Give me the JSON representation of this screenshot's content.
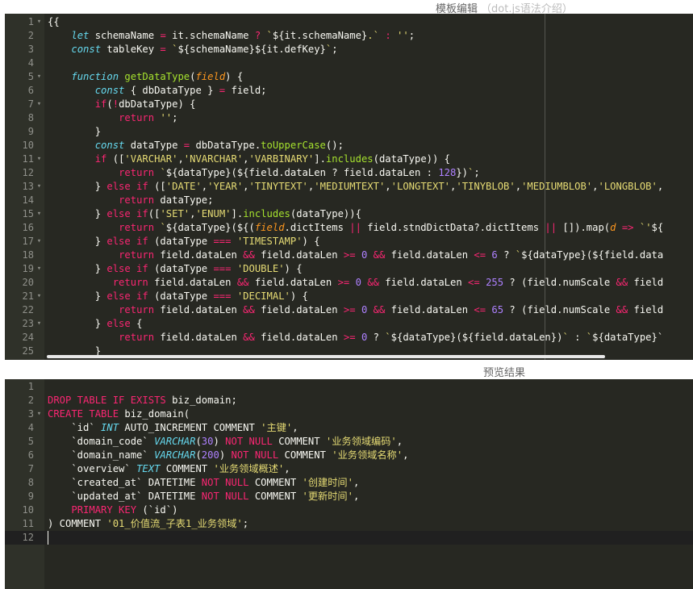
{
  "template_section": {
    "title": "模板编辑",
    "subtitle": "（dot.js语法介绍）"
  },
  "preview_section": {
    "title": "预览结果"
  },
  "template_code": [
    [
      [
        "t",
        "{{"
      ]
    ],
    [
      [
        "t",
        "    "
      ],
      [
        "sp",
        "let"
      ],
      [
        "t",
        " schemaName "
      ],
      [
        "kw",
        "="
      ],
      [
        "t",
        " it.schemaName "
      ],
      [
        "kw",
        "?"
      ],
      [
        "t",
        " "
      ],
      [
        "st",
        "`"
      ],
      [
        "t",
        "${it.schemaName}"
      ],
      [
        "st",
        ".`"
      ],
      [
        "t",
        " "
      ],
      [
        "kw",
        ":"
      ],
      [
        "t",
        " "
      ],
      [
        "st",
        "''"
      ],
      [
        "t",
        ";"
      ]
    ],
    [
      [
        "t",
        "    "
      ],
      [
        "sp",
        "const"
      ],
      [
        "t",
        " tableKey "
      ],
      [
        "kw",
        "="
      ],
      [
        "t",
        " "
      ],
      [
        "st",
        "`"
      ],
      [
        "t",
        "${schemaName}${it.defKey}"
      ],
      [
        "st",
        "`"
      ],
      [
        "t",
        ";"
      ]
    ],
    [
      [
        "t",
        ""
      ]
    ],
    [
      [
        "t",
        "    "
      ],
      [
        "sp",
        "function"
      ],
      [
        "t",
        " "
      ],
      [
        "fn",
        "getDataType"
      ],
      [
        "t",
        "("
      ],
      [
        "pa",
        "field"
      ],
      [
        "t",
        ") {"
      ]
    ],
    [
      [
        "t",
        "        "
      ],
      [
        "sp",
        "const"
      ],
      [
        "t",
        " { dbDataType } "
      ],
      [
        "kw",
        "="
      ],
      [
        "t",
        " field;"
      ]
    ],
    [
      [
        "t",
        "        "
      ],
      [
        "kw",
        "if"
      ],
      [
        "t",
        "("
      ],
      [
        "kw",
        "!"
      ],
      [
        "t",
        "dbDataType) {"
      ]
    ],
    [
      [
        "t",
        "            "
      ],
      [
        "kw",
        "return"
      ],
      [
        "t",
        " "
      ],
      [
        "st",
        "''"
      ],
      [
        "t",
        ";"
      ]
    ],
    [
      [
        "t",
        "        }"
      ]
    ],
    [
      [
        "t",
        "        "
      ],
      [
        "sp",
        "const"
      ],
      [
        "t",
        " dataType "
      ],
      [
        "kw",
        "="
      ],
      [
        "t",
        " dbDataType."
      ],
      [
        "fn",
        "toUpperCase"
      ],
      [
        "t",
        "();"
      ]
    ],
    [
      [
        "t",
        "        "
      ],
      [
        "kw",
        "if"
      ],
      [
        "t",
        " (["
      ],
      [
        "st",
        "'VARCHAR'"
      ],
      [
        "t",
        ","
      ],
      [
        "st",
        "'NVARCHAR'"
      ],
      [
        "t",
        ","
      ],
      [
        "st",
        "'VARBINARY'"
      ],
      [
        "t",
        "]."
      ],
      [
        "fn",
        "includes"
      ],
      [
        "t",
        "(dataType)) {"
      ]
    ],
    [
      [
        "t",
        "            "
      ],
      [
        "kw",
        "return"
      ],
      [
        "t",
        " "
      ],
      [
        "st",
        "`"
      ],
      [
        "t",
        "${dataType}("
      ],
      [
        "t",
        "${field.dataLen ? field.dataLen : "
      ],
      [
        "nu",
        "128"
      ],
      [
        "t",
        "})"
      ],
      [
        "st",
        "`"
      ],
      [
        "t",
        ";"
      ]
    ],
    [
      [
        "t",
        "        } "
      ],
      [
        "kw",
        "else if"
      ],
      [
        "t",
        " (["
      ],
      [
        "st",
        "'DATE'"
      ],
      [
        "t",
        ","
      ],
      [
        "st",
        "'YEAR'"
      ],
      [
        "t",
        ","
      ],
      [
        "st",
        "'TINYTEXT'"
      ],
      [
        "t",
        ","
      ],
      [
        "st",
        "'MEDIUMTEXT'"
      ],
      [
        "t",
        ","
      ],
      [
        "st",
        "'LONGTEXT'"
      ],
      [
        "t",
        ","
      ],
      [
        "st",
        "'TINYBLOB'"
      ],
      [
        "t",
        ","
      ],
      [
        "st",
        "'MEDIUMBLOB'"
      ],
      [
        "t",
        ","
      ],
      [
        "st",
        "'LONGBLOB'"
      ],
      [
        "t",
        ","
      ]
    ],
    [
      [
        "t",
        "            "
      ],
      [
        "kw",
        "return"
      ],
      [
        "t",
        " dataType;"
      ]
    ],
    [
      [
        "t",
        "        } "
      ],
      [
        "kw",
        "else if"
      ],
      [
        "t",
        "(["
      ],
      [
        "st",
        "'SET'"
      ],
      [
        "t",
        ","
      ],
      [
        "st",
        "'ENUM'"
      ],
      [
        "t",
        "]."
      ],
      [
        "fn",
        "includes"
      ],
      [
        "t",
        "(dataType)){"
      ]
    ],
    [
      [
        "t",
        "            "
      ],
      [
        "kw",
        "return"
      ],
      [
        "t",
        " "
      ],
      [
        "st",
        "`"
      ],
      [
        "t",
        "${dataType}(${("
      ],
      [
        "pa",
        "field"
      ],
      [
        "t",
        ".dictItems "
      ],
      [
        "kw",
        "||"
      ],
      [
        "t",
        " field.stndDictData?.dictItems "
      ],
      [
        "kw",
        "||"
      ],
      [
        "t",
        " []).map("
      ],
      [
        "pa",
        "d"
      ],
      [
        "t",
        " "
      ],
      [
        "kw",
        "=>"
      ],
      [
        "t",
        " "
      ],
      [
        "st",
        "`'"
      ],
      [
        "t",
        "${"
      ]
    ],
    [
      [
        "t",
        "        } "
      ],
      [
        "kw",
        "else if"
      ],
      [
        "t",
        " (dataType "
      ],
      [
        "kw",
        "==="
      ],
      [
        "t",
        " "
      ],
      [
        "st",
        "'TIMESTAMP'"
      ],
      [
        "t",
        ") {"
      ]
    ],
    [
      [
        "t",
        "            "
      ],
      [
        "kw",
        "return"
      ],
      [
        "t",
        " field.dataLen "
      ],
      [
        "kw",
        "&&"
      ],
      [
        "t",
        " field.dataLen "
      ],
      [
        "kw",
        "&gt;="
      ],
      [
        "t",
        " "
      ],
      [
        "nu",
        "0"
      ],
      [
        "t",
        " "
      ],
      [
        "kw",
        "&amp;&amp;"
      ],
      [
        "t",
        " field.dataLen "
      ],
      [
        "kw",
        "&lt;="
      ],
      [
        "t",
        " "
      ],
      [
        "nu",
        "6"
      ],
      [
        "t",
        " ? "
      ],
      [
        "st",
        "`"
      ],
      [
        "t",
        "${dataType}(${field.data"
      ]
    ],
    [
      [
        "t",
        "        } "
      ],
      [
        "kw",
        "else if"
      ],
      [
        "t",
        " (dataType "
      ],
      [
        "kw",
        "==="
      ],
      [
        "t",
        " "
      ],
      [
        "st",
        "'DOUBLE'"
      ],
      [
        "t",
        ") {"
      ]
    ],
    [
      [
        "t",
        "           "
      ],
      [
        "kw",
        "return"
      ],
      [
        "t",
        " field.dataLen "
      ],
      [
        "kw",
        "&&"
      ],
      [
        "t",
        " field.dataLen "
      ],
      [
        "kw",
        "&gt;="
      ],
      [
        "t",
        " "
      ],
      [
        "nu",
        "0"
      ],
      [
        "t",
        " "
      ],
      [
        "kw",
        "&amp;&amp;"
      ],
      [
        "t",
        " field.dataLen "
      ],
      [
        "kw",
        "&lt;="
      ],
      [
        "t",
        " "
      ],
      [
        "nu",
        "255"
      ],
      [
        "t",
        " ? (field.numScale "
      ],
      [
        "kw",
        "&&"
      ],
      [
        "t",
        " field"
      ]
    ],
    [
      [
        "t",
        "        } "
      ],
      [
        "kw",
        "else if"
      ],
      [
        "t",
        " (dataType "
      ],
      [
        "kw",
        "==="
      ],
      [
        "t",
        " "
      ],
      [
        "st",
        "'DECIMAL'"
      ],
      [
        "t",
        ") {"
      ]
    ],
    [
      [
        "t",
        "            "
      ],
      [
        "kw",
        "return"
      ],
      [
        "t",
        " field.dataLen "
      ],
      [
        "kw",
        "&&"
      ],
      [
        "t",
        " field.dataLen "
      ],
      [
        "kw",
        "&gt;="
      ],
      [
        "t",
        " "
      ],
      [
        "nu",
        "0"
      ],
      [
        "t",
        " "
      ],
      [
        "kw",
        "&amp;&amp;"
      ],
      [
        "t",
        " field.dataLen "
      ],
      [
        "kw",
        "&lt;="
      ],
      [
        "t",
        " "
      ],
      [
        "nu",
        "65"
      ],
      [
        "t",
        " ? (field.numScale "
      ],
      [
        "kw",
        "&&"
      ],
      [
        "t",
        " field"
      ]
    ],
    [
      [
        "t",
        "        } "
      ],
      [
        "kw",
        "else"
      ],
      [
        "t",
        " {"
      ]
    ],
    [
      [
        "t",
        "            "
      ],
      [
        "kw",
        "return"
      ],
      [
        "t",
        " field.dataLen "
      ],
      [
        "kw",
        "&&"
      ],
      [
        "t",
        " field.dataLen "
      ],
      [
        "kw",
        "&gt;="
      ],
      [
        "t",
        " "
      ],
      [
        "nu",
        "0"
      ],
      [
        "t",
        " ? "
      ],
      [
        "st",
        "`"
      ],
      [
        "t",
        "${dataType}(${field.dataLen})"
      ],
      [
        "st",
        "`"
      ],
      [
        "t",
        " : "
      ],
      [
        "st",
        "`"
      ],
      [
        "t",
        "${dataType}`"
      ]
    ],
    [
      [
        "t",
        "        }"
      ]
    ]
  ],
  "template_line_numbers": [
    "1",
    "2",
    "3",
    "4",
    "5",
    "6",
    "7",
    "8",
    "9",
    "10",
    "11",
    "12",
    "13",
    "14",
    "15",
    "16",
    "17",
    "18",
    "19",
    "20",
    "21",
    "22",
    "23",
    "24",
    "25"
  ],
  "template_fold_lines": [
    1,
    5,
    7,
    11,
    13,
    15,
    17,
    19,
    21,
    23
  ],
  "preview_code": [
    [
      [
        "t",
        ""
      ]
    ],
    [
      [
        "kw",
        "DROP TABLE IF EXISTS"
      ],
      [
        "t",
        " biz_domain;"
      ]
    ],
    [
      [
        "kw",
        "CREATE TABLE"
      ],
      [
        "t",
        " biz_domain("
      ]
    ],
    [
      [
        "t",
        "    `id` "
      ],
      [
        "sp",
        "INT"
      ],
      [
        "t",
        " AUTO_INCREMENT COMMENT "
      ],
      [
        "st",
        "'主键'"
      ],
      [
        "t",
        ","
      ]
    ],
    [
      [
        "t",
        "    `domain_code` "
      ],
      [
        "sp",
        "VARCHAR"
      ],
      [
        "t",
        "("
      ],
      [
        "nu",
        "30"
      ],
      [
        "t",
        ") "
      ],
      [
        "kw",
        "NOT NULL"
      ],
      [
        "t",
        " COMMENT "
      ],
      [
        "st",
        "'业务领域编码'"
      ],
      [
        "t",
        ","
      ]
    ],
    [
      [
        "t",
        "    `domain_name` "
      ],
      [
        "sp",
        "VARCHAR"
      ],
      [
        "t",
        "("
      ],
      [
        "nu",
        "200"
      ],
      [
        "t",
        ") "
      ],
      [
        "kw",
        "NOT NULL"
      ],
      [
        "t",
        " COMMENT "
      ],
      [
        "st",
        "'业务领域名称'"
      ],
      [
        "t",
        ","
      ]
    ],
    [
      [
        "t",
        "    `overview` "
      ],
      [
        "sp",
        "TEXT"
      ],
      [
        "t",
        " COMMENT "
      ],
      [
        "st",
        "'业务领域概述'"
      ],
      [
        "t",
        ","
      ]
    ],
    [
      [
        "t",
        "    `created_at` DATETIME "
      ],
      [
        "kw",
        "NOT NULL"
      ],
      [
        "t",
        " COMMENT "
      ],
      [
        "st",
        "'创建时间'"
      ],
      [
        "t",
        ","
      ]
    ],
    [
      [
        "t",
        "    `updated_at` DATETIME "
      ],
      [
        "kw",
        "NOT NULL"
      ],
      [
        "t",
        " COMMENT "
      ],
      [
        "st",
        "'更新时间'"
      ],
      [
        "t",
        ","
      ]
    ],
    [
      [
        "t",
        "    "
      ],
      [
        "kw",
        "PRIMARY KEY"
      ],
      [
        "t",
        " (`id`)"
      ]
    ],
    [
      [
        "t",
        ") COMMENT "
      ],
      [
        "st",
        "'01_价值流_子表1_业务领域'"
      ],
      [
        "t",
        ";"
      ]
    ],
    [
      [
        "t",
        ""
      ]
    ]
  ],
  "preview_line_numbers": [
    "1",
    "2",
    "3",
    "4",
    "5",
    "6",
    "7",
    "8",
    "9",
    "10",
    "11",
    "12"
  ],
  "preview_fold_lines": [
    3
  ]
}
